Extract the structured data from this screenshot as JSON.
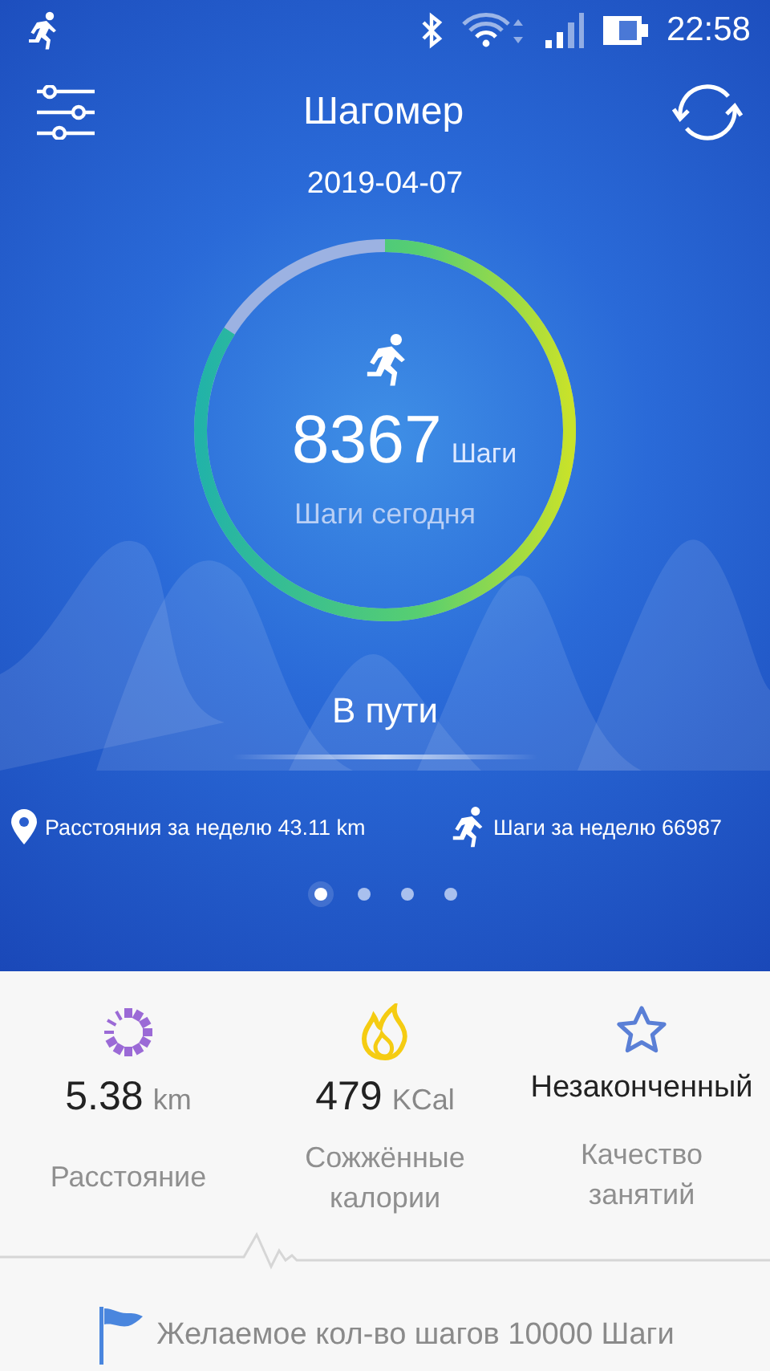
{
  "status_bar": {
    "time": "22:58"
  },
  "header": {
    "title": "Шагомер",
    "date": "2019-04-07"
  },
  "steps": {
    "value": "8367",
    "unit": "Шаги",
    "caption": "Шаги сегодня",
    "level": 0.84
  },
  "state_label": "В пути",
  "weekly": [
    {
      "kind": "distance",
      "text": "Расстояния за неделю 43.11 km"
    },
    {
      "kind": "steps",
      "text": "Шаги за неделю 66987"
    }
  ],
  "pages": [
    {
      "selected": true
    },
    {
      "selected": false
    },
    {
      "selected": false
    },
    {
      "selected": false
    }
  ],
  "stats": [
    {
      "kind": "distance",
      "value": "5.38",
      "unit": "km",
      "label": "Расстояние"
    },
    {
      "kind": "calories",
      "value": "479",
      "unit": "KCal",
      "label": "Сожжённые калории"
    },
    {
      "kind": "quality",
      "value": "Незаконченный",
      "label": "Качество занятий"
    }
  ],
  "goal": "Желаемое кол-во шагов 10000 Шаги"
}
